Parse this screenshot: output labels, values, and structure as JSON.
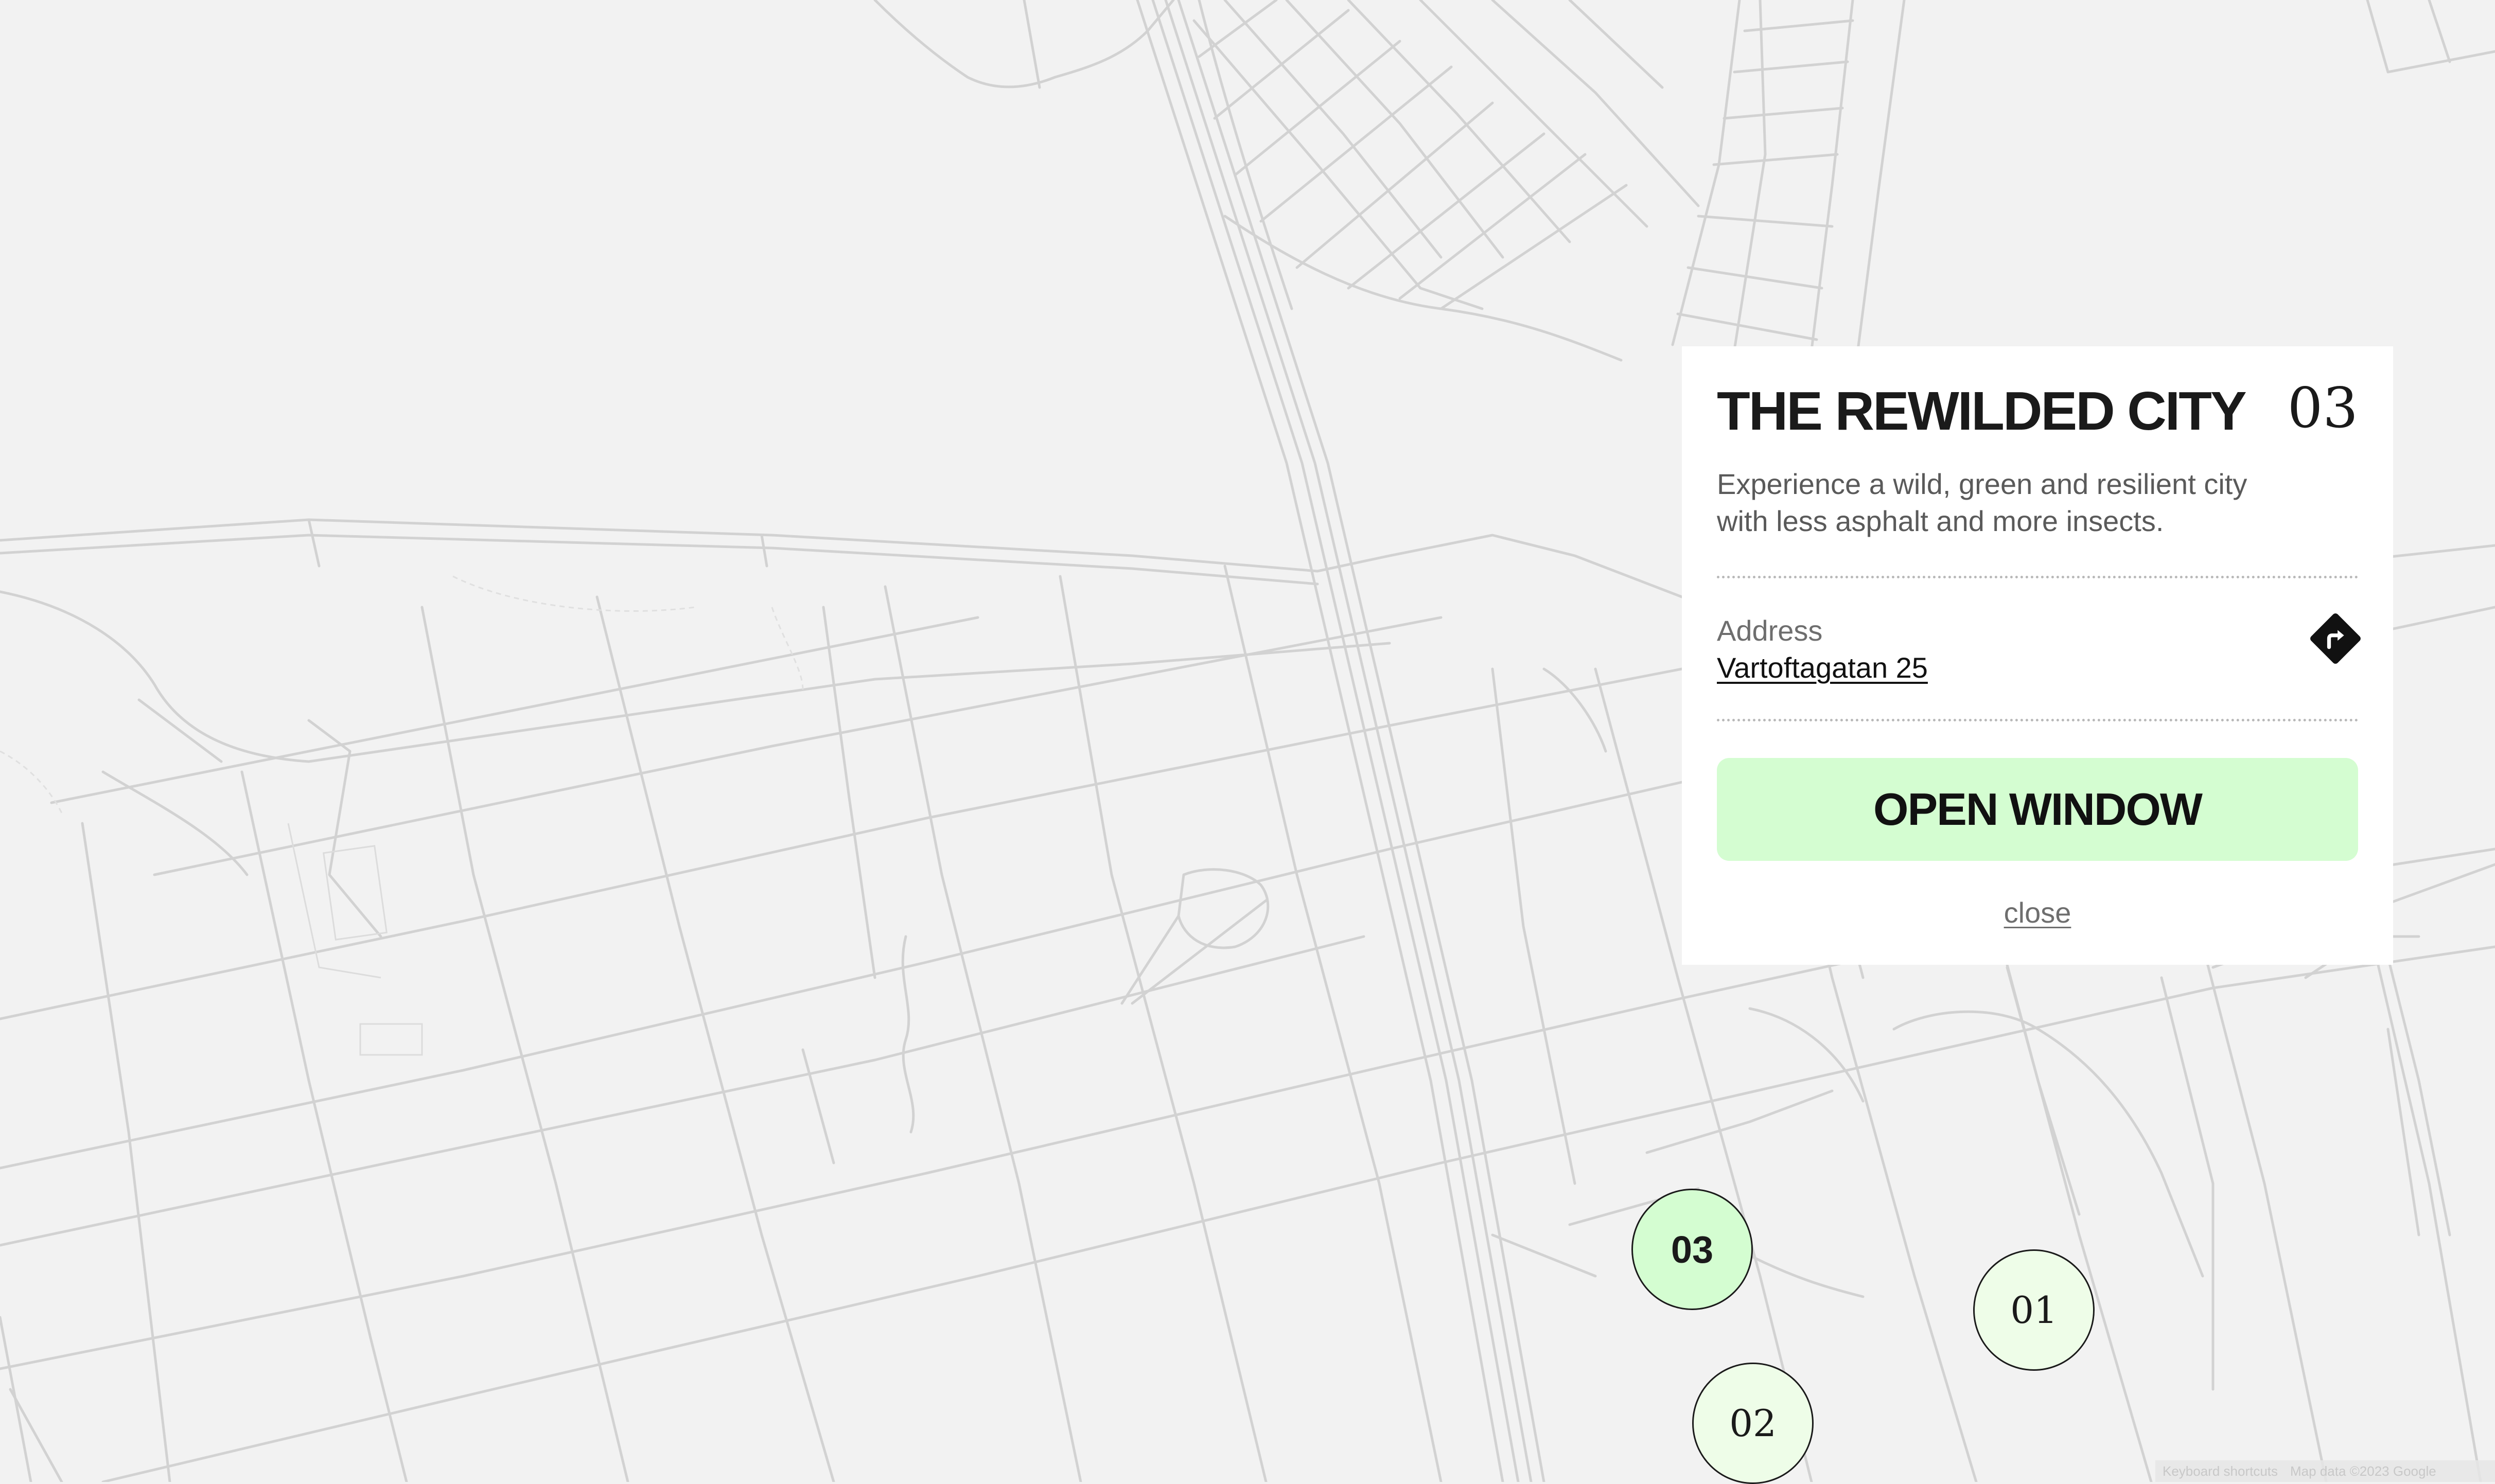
{
  "info_panel": {
    "title": "THE REWILDED CITY",
    "number": "03",
    "description": "Experience a wild, green and resilient city with less asphalt and more insects.",
    "address_label": "Address",
    "address_value": "Vartoftagatan 25",
    "directions_icon": "directions-turn-right-icon",
    "open_button_label": "OPEN WINDOW",
    "close_label": "close"
  },
  "markers": [
    {
      "label": "03",
      "state": "active"
    },
    {
      "label": "01",
      "state": "inactive"
    },
    {
      "label": "02",
      "state": "inactive"
    }
  ],
  "attribution": {
    "shortcuts": "Keyboard shortcuts",
    "map_data": "Map data ©2023 Google"
  },
  "colors": {
    "map_background": "#f2f2f2",
    "road": "#cfcfcf",
    "accent_green": "#d4fdd1",
    "marker_light_green": "#eefde8",
    "text_dark": "#1a1a1a"
  }
}
